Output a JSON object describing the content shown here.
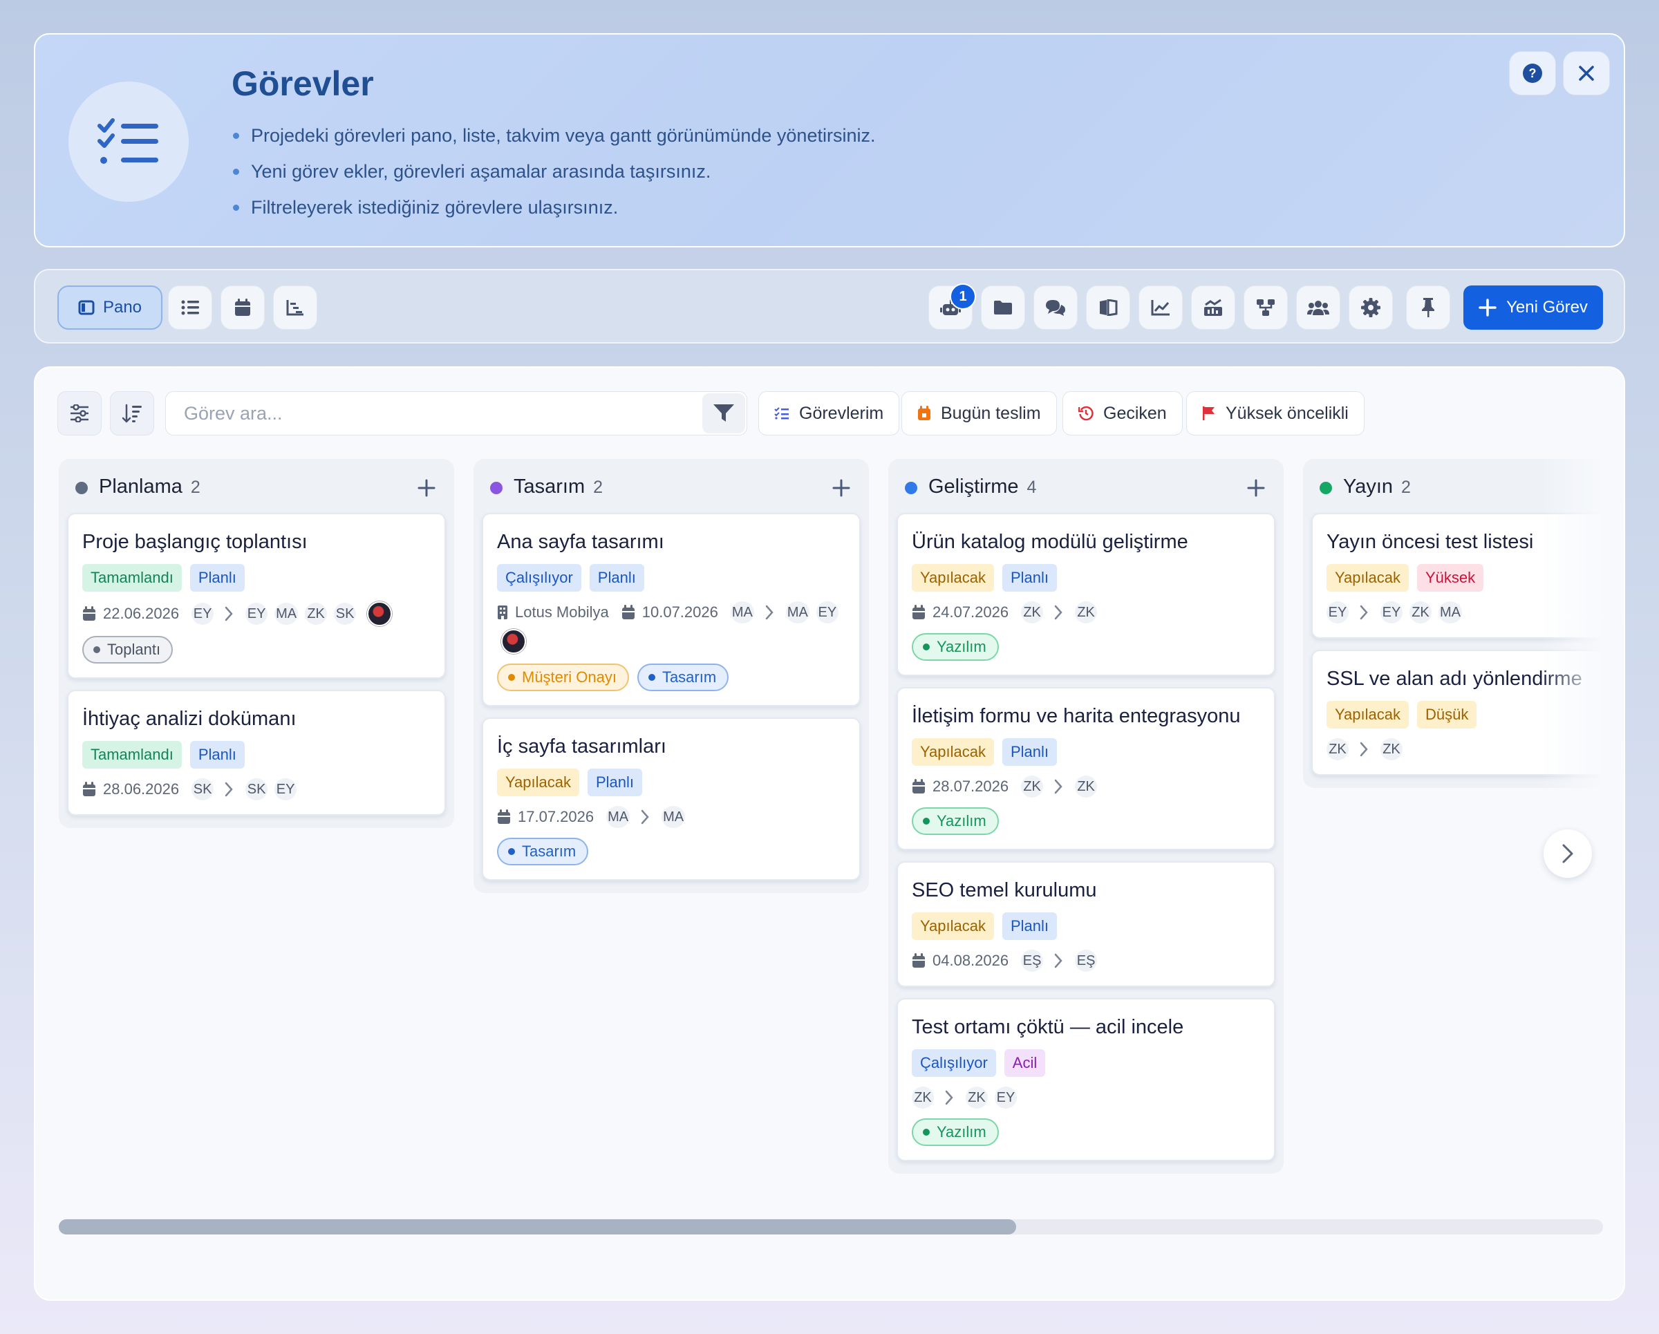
{
  "header": {
    "title": "Görevler",
    "bullets": [
      "Projedeki görevleri pano, liste, takvim veya gantt görünümünde yönetirsiniz.",
      "Yeni görev ekler, görevleri aşamalar arasında taşırsınız.",
      "Filtreleyerek istediğiniz görevlere ulaşırsınız."
    ],
    "help_icon": "question-circle-icon",
    "close_icon": "close-icon"
  },
  "toolbar": {
    "views": [
      {
        "label": "Pano",
        "icon": "board-icon",
        "active": true
      },
      {
        "icon": "list-icon"
      },
      {
        "icon": "calendar-icon"
      },
      {
        "icon": "gantt-icon"
      }
    ],
    "tools": [
      {
        "icon": "robot-icon",
        "badge": "1"
      },
      {
        "icon": "folder-icon"
      },
      {
        "icon": "comments-icon"
      },
      {
        "icon": "book-icon"
      },
      {
        "icon": "line-chart-icon"
      },
      {
        "icon": "analytics-icon"
      },
      {
        "icon": "workflow-icon"
      },
      {
        "icon": "users-icon"
      },
      {
        "icon": "gear-icon"
      },
      {
        "icon": "pin-icon"
      }
    ],
    "new_task_label": "Yeni Görev"
  },
  "filters": {
    "search_placeholder": "Görev ara...",
    "chips": [
      "Görevlerim",
      "Bugün teslim",
      "Geciken",
      "Yüksek öncelikli"
    ]
  },
  "columns": [
    {
      "title": "Planlama",
      "count": "2",
      "color": "#5f6b80",
      "cards": [
        {
          "title": "Proje başlangıç toplantısı",
          "tags": [
            "Tamamlandı",
            "Planlı"
          ],
          "date": "22.06.2026",
          "from": "EY",
          "to": [
            "EY"
          ],
          "extra": [
            "MA",
            "ZK",
            "SK"
          ],
          "labels": [
            "Toplantı"
          ]
        },
        {
          "title": "İhtiyaç analizi dokümanı",
          "tags": [
            "Tamamlandı",
            "Planlı"
          ],
          "date": "28.06.2026",
          "from": "SK",
          "to": [
            "SK"
          ],
          "extra": [
            "EY"
          ],
          "labels": []
        }
      ]
    },
    {
      "title": "Tasarım",
      "count": "2",
      "color": "#8a55e0",
      "cards": [
        {
          "title": "Ana sayfa tasarımı",
          "tags": [
            "Çalışılıyor",
            "Planlı"
          ],
          "company": "Lotus Mobilya",
          "date": "10.07.2026",
          "from": "MA",
          "to": [
            "MA"
          ],
          "extra": [
            "EY"
          ],
          "labels": [
            "Müşteri Onayı",
            "Tasarım"
          ]
        },
        {
          "title": "İç sayfa tasarımları",
          "tags": [
            "Yapılacak",
            "Planlı"
          ],
          "date": "17.07.2026",
          "from": "MA",
          "to": [
            "MA"
          ],
          "extra": [],
          "labels": [
            "Tasarım"
          ]
        }
      ]
    },
    {
      "title": "Geliştirme",
      "count": "4",
      "color": "#2f7ae8",
      "cards": [
        {
          "title": "Ürün katalog modülü geliştirme",
          "tags": [
            "Yapılacak",
            "Planlı"
          ],
          "date": "24.07.2026",
          "from": "ZK",
          "to": [
            "ZK"
          ],
          "extra": [],
          "labels": [
            "Yazılım"
          ]
        },
        {
          "title": "İletişim formu ve harita entegrasyonu",
          "tags": [
            "Yapılacak",
            "Planlı"
          ],
          "date": "28.07.2026",
          "from": "ZK",
          "to": [
            "ZK"
          ],
          "extra": [],
          "labels": [
            "Yazılım"
          ]
        },
        {
          "title": "SEO temel kurulumu",
          "tags": [
            "Yapılacak",
            "Planlı"
          ],
          "date": "04.08.2026",
          "from": "EŞ",
          "to": [
            "EŞ"
          ],
          "extra": [],
          "labels": []
        },
        {
          "title": "Test ortamı çöktü — acil incele",
          "tags": [
            "Çalışılıyor",
            "Acil"
          ],
          "from": "ZK",
          "to": [
            "ZK"
          ],
          "extra": [
            "EY"
          ],
          "labels": [
            "Yazılım"
          ]
        }
      ]
    },
    {
      "title": "Yayın",
      "count": "2",
      "color": "#17a765",
      "cards": [
        {
          "title": "Yayın öncesi test listesi",
          "tags": [
            "Yapılacak",
            "Yüksek"
          ],
          "from": "EY",
          "to": [
            "EY"
          ],
          "extra": [
            "ZK",
            "MA"
          ],
          "labels": []
        },
        {
          "title": "SSL ve alan adı yönlendirme",
          "tags": [
            "Yapılacak",
            "Düşük"
          ],
          "from": "ZK",
          "to": [
            "ZK"
          ],
          "extra": [],
          "labels": []
        }
      ]
    }
  ],
  "scroll_progress": 0.62
}
